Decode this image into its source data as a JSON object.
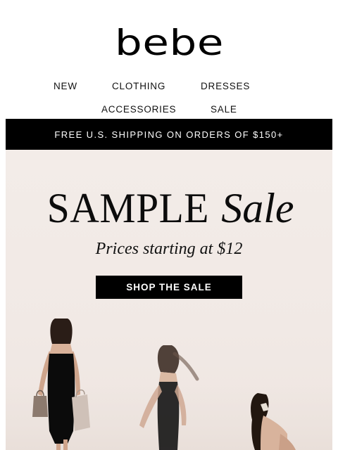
{
  "brand": {
    "logo_text": "bebe"
  },
  "nav": {
    "items": [
      {
        "label": "NEW"
      },
      {
        "label": "CLOTHING"
      },
      {
        "label": "DRESSES"
      },
      {
        "label": "ACCESSORIES"
      },
      {
        "label": "SALE"
      }
    ]
  },
  "promo_bar": {
    "text": "FREE U.S. SHIPPING ON ORDERS OF $150+"
  },
  "hero": {
    "title_main": "SAMPLE",
    "title_accent": "Sale",
    "subtitle": "Prices starting at $12",
    "cta_label": "SHOP THE SALE",
    "image_description_icon": "models-walking-photo"
  },
  "colors": {
    "brand_black": "#000000",
    "hero_background": "#f3ece8",
    "text_white": "#ffffff"
  }
}
